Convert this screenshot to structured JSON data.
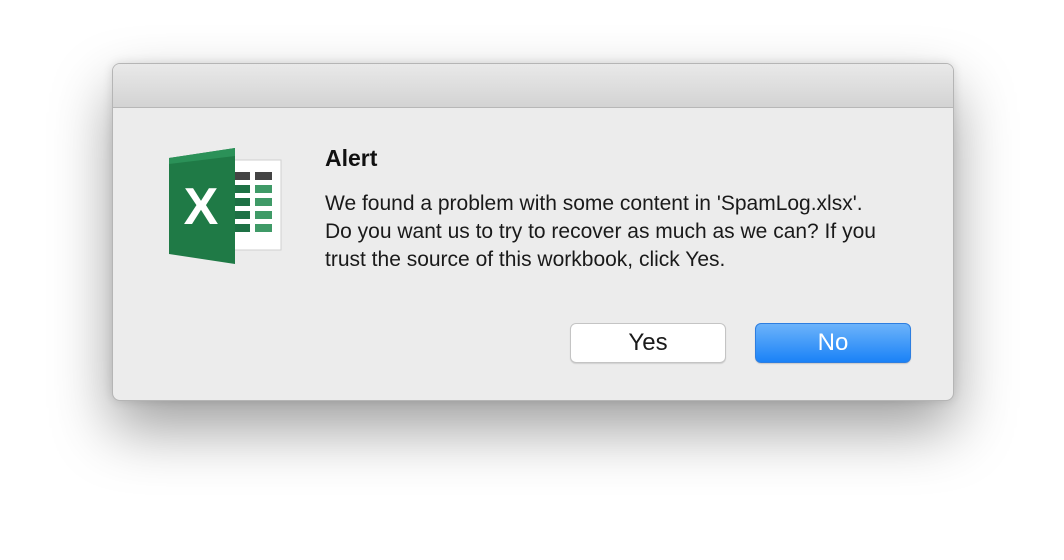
{
  "dialog": {
    "icon": "excel-app-icon",
    "title": "Alert",
    "message": "We found a problem with some content in 'SpamLog.xlsx'. Do you want us to try to recover as much as we can? If you trust the source of this workbook, click Yes.",
    "buttons": {
      "yes_label": "Yes",
      "no_label": "No"
    }
  },
  "colors": {
    "default_button": "#1a82f7",
    "excel_green": "#1e7145"
  }
}
